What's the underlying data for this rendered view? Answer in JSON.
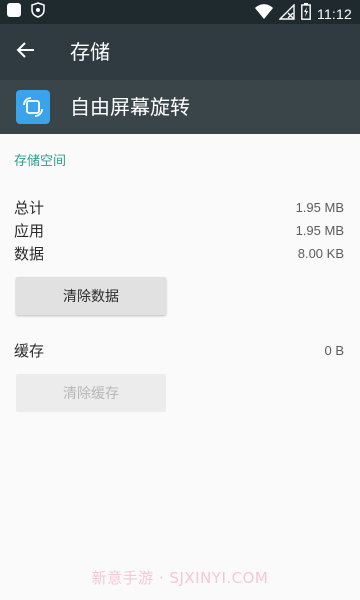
{
  "status_bar": {
    "time": "11:12"
  },
  "app_bar": {
    "title": "存储"
  },
  "app_header": {
    "name": "自由屏幕旋转"
  },
  "storage": {
    "section_title": "存储空间",
    "rows": [
      {
        "label": "总计",
        "value": "1.95 MB"
      },
      {
        "label": "应用",
        "value": "1.95 MB"
      },
      {
        "label": "数据",
        "value": "8.00 KB"
      }
    ],
    "clear_data_label": "清除数据"
  },
  "cache": {
    "label": "缓存",
    "value": "0 B",
    "clear_cache_label": "清除缓存"
  },
  "watermark": "新意手游 · SJXINYI.COM",
  "colors": {
    "status_bar_bg": "#1f2a2f",
    "app_bar_bg": "#2f3b40",
    "header_bg": "#3a454a",
    "accent_teal": "#2e9c8a",
    "app_icon_blue": "#3ba3ea"
  },
  "icons": {
    "status_left": [
      "square-app-icon",
      "shield-icon"
    ],
    "status_right": [
      "wifi-icon",
      "no-signal-icon",
      "battery-icon"
    ],
    "back": "back-arrow-icon",
    "app": "rotate-screen-icon"
  }
}
